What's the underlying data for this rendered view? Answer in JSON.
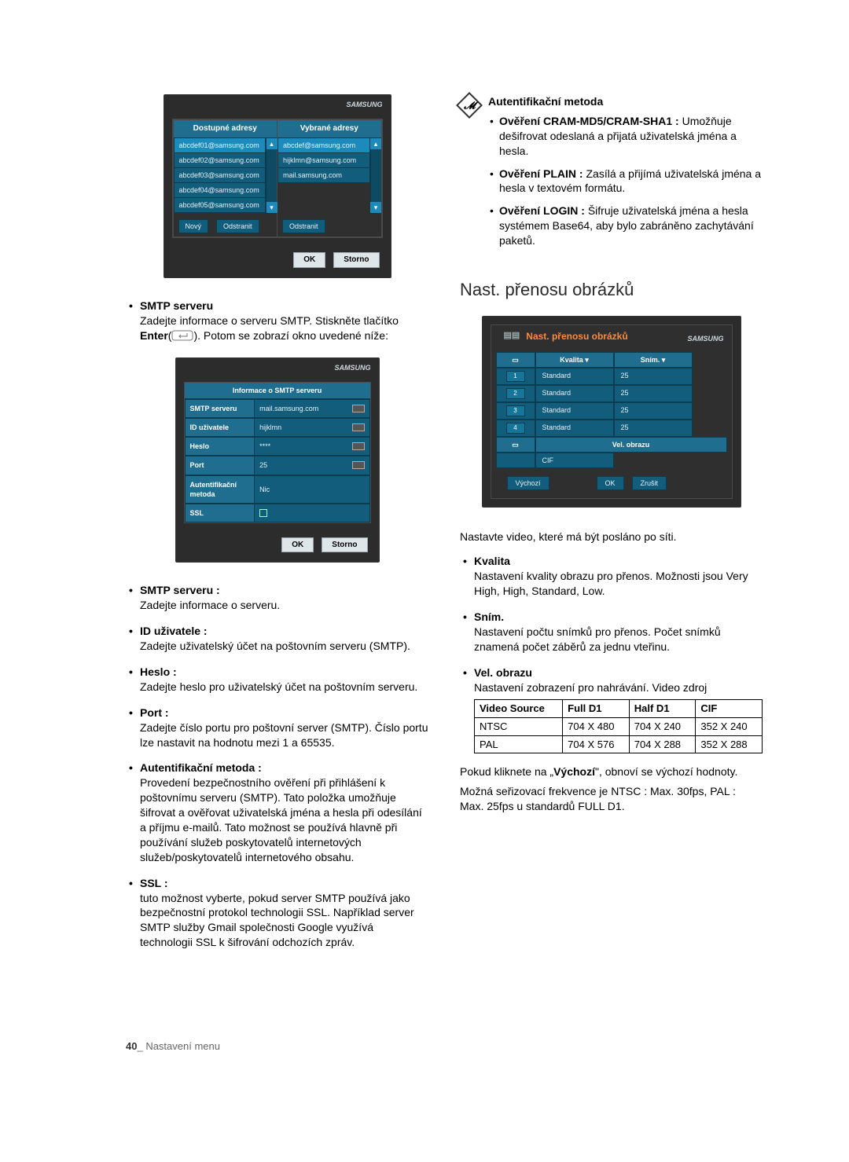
{
  "addr_box": {
    "available_header": "Dostupné adresy",
    "selected_header": "Vybrané adresy",
    "available": [
      "abcdef01@samsung.com",
      "abcdef02@samsung.com",
      "abcdef03@samsung.com",
      "abcdef04@samsung.com",
      "abcdef05@samsung.com"
    ],
    "selected": [
      "abcdef@samsung.com",
      "hijklmn@samsung.com",
      "mail.samsung.com"
    ],
    "btn_new": "Nový",
    "btn_remove_left": "Odstranit",
    "btn_remove_right": "Odstranit",
    "btn_ok": "OK",
    "btn_cancel": "Storno",
    "brand": "SAMSUNG"
  },
  "smtp_lead": {
    "head": "SMTP serveru",
    "line1": "Zadejte informace o serveru SMTP. Stiskněte tlačítko",
    "enter_label": "Enter",
    "line2_suffix": ". Potom se zobrazí okno uvedené níže:"
  },
  "smtp_box": {
    "title": "Informace o SMTP serveru",
    "rows": [
      {
        "label": "SMTP serveru",
        "value": "mail.samsung.com",
        "kbd": true
      },
      {
        "label": "ID uživatele",
        "value": "hijklmn",
        "kbd": true
      },
      {
        "label": "Heslo",
        "value": "****",
        "kbd": true
      },
      {
        "label": "Port",
        "value": "25",
        "kbd": true
      },
      {
        "label": "Autentifikační metoda",
        "value": "Nic",
        "kbd": false
      },
      {
        "label": "SSL",
        "value": "",
        "kbd": false
      }
    ],
    "btn_ok": "OK",
    "btn_cancel": "Storno",
    "brand": "SAMSUNG"
  },
  "smtp_list": [
    {
      "lead": "SMTP serveru :",
      "body": "Zadejte informace o serveru."
    },
    {
      "lead": "ID uživatele :",
      "body": "Zadejte uživatelský účet na poštovním serveru (SMTP)."
    },
    {
      "lead": "Heslo :",
      "body": "Zadejte heslo pro uživatelský účet na poštovním serveru."
    },
    {
      "lead": "Port :",
      "body": "Zadejte číslo portu pro poštovní server (SMTP). Číslo portu lze nastavit na hodnotu mezi 1 a 65535."
    },
    {
      "lead": "Autentifikační metoda :",
      "body": "Provedení bezpečnostního ověření při přihlášení k poštovnímu serveru (SMTP). Tato položka umožňuje šifrovat a ověřovat uživatelská jména a hesla při odesílání a příjmu e-mailů. Tato možnost se používá hlavně při používání služeb poskytovatelů internetových služeb/poskytovatelů internetového obsahu."
    },
    {
      "lead": "SSL :",
      "body": "tuto možnost vyberte, pokud server SMTP používá jako bezpečnostní protokol technologii SSL. Například server SMTP služby Gmail společnosti Google využívá technologii SSL k šifrování odchozích zpráv."
    }
  ],
  "auth_note_head": "Autentifikační metoda",
  "auth_note": [
    {
      "lead": "Ověření CRAM-MD5/CRAM-SHA1 :",
      "body": "Umožňuje dešifrovat odeslaná a přijatá uživatelská jména a hesla."
    },
    {
      "lead": "Ověření PLAIN :",
      "body": "Zasílá a přijímá uživatelská jména a hesla v textovém formátu."
    },
    {
      "lead": "Ověření LOGIN :",
      "body": "Šifruje uživatelská jména a hesla systémem Base64, aby bylo zabráněno zachytávání paketů."
    }
  ],
  "transfer_heading": "Nast. přenosu obrázků",
  "transfer_box": {
    "title": "Nast. přenosu obrázků",
    "brand": "SAMSUNG",
    "col_kvalita": "Kvalita",
    "col_snim": "Sním.",
    "tri_glyph": "▾",
    "rows": [
      {
        "icon": "1",
        "q": "Standard",
        "s": "25"
      },
      {
        "icon": "2",
        "q": "Standard",
        "s": "25"
      },
      {
        "icon": "3",
        "q": "Standard",
        "s": "25"
      },
      {
        "icon": "4",
        "q": "Standard",
        "s": "25"
      }
    ],
    "vel_row_label": "Vel. obrazu",
    "cif_row_label": "CIF",
    "btn_default": "Výchozí",
    "btn_ok": "OK",
    "btn_cancel": "Zrušit"
  },
  "transfer_intro": "Nastavte video, které má být posláno po síti.",
  "transfer_list": [
    {
      "lead": "Kvalita",
      "body": "Nastavení kvality obrazu pro přenos. Možnosti jsou Very High, High, Standard, Low."
    },
    {
      "lead": "Sním.",
      "body": "Nastavení počtu snímků pro přenos. Počet snímků znamená počet záběrů za jednu vteřinu."
    },
    {
      "lead": "Vel. obrazu",
      "body": "Nastavení zobrazení pro nahrávání. Video zdroj"
    }
  ],
  "vid_table": {
    "headers": [
      "Video Source",
      "Full D1",
      "Half D1",
      "CIF"
    ],
    "rows": [
      [
        "NTSC",
        "704 X 480",
        "704 X 240",
        "352 X 240"
      ],
      [
        "PAL",
        "704 X 576",
        "704 X 288",
        "352 X 288"
      ]
    ]
  },
  "transfer_footer_p1a": "Pokud kliknete na „",
  "transfer_footer_p1b": "Výchozí",
  "transfer_footer_p1c": "\", obnoví se výchozí hodnoty.",
  "transfer_footer_p2": "Možná seřizovací frekvence je NTSC : Max. 30fps, PAL : Max. 25fps u standardů FULL D1.",
  "page_number": "40",
  "page_label": "Nastavení menu"
}
